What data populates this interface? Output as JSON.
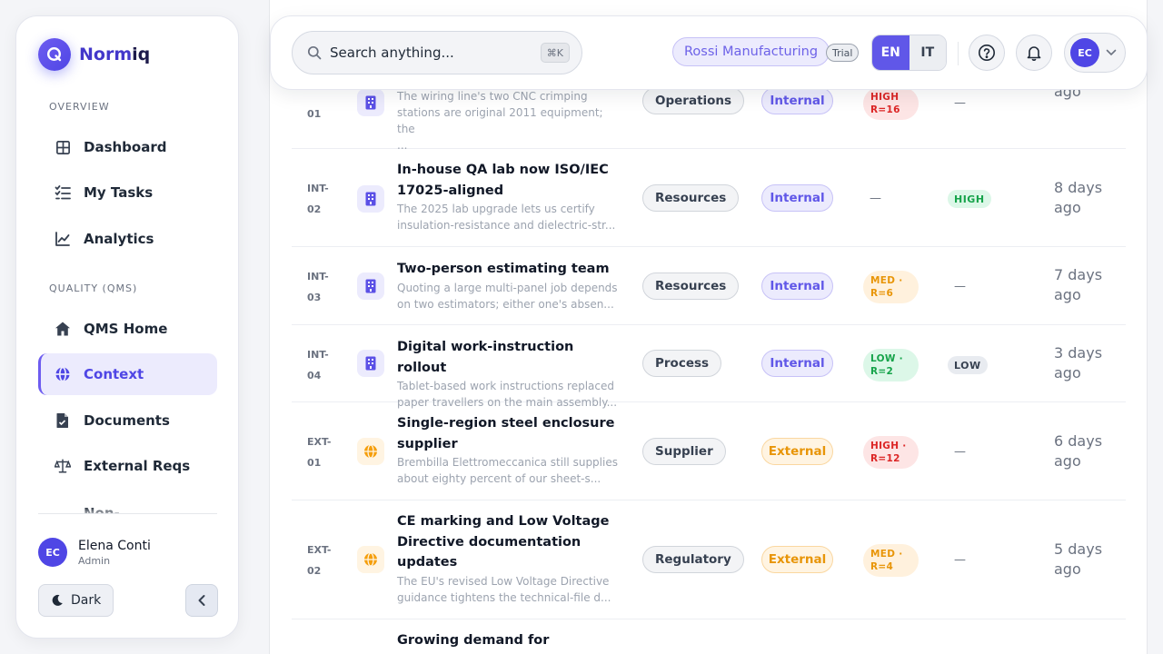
{
  "brand": {
    "name_a": "Norm",
    "name_b": "iq"
  },
  "sidebar": {
    "sections": [
      "OVERVIEW",
      "QUALITY (QMS)"
    ],
    "items": [
      {
        "label": "Dashboard",
        "icon": "grid-icon"
      },
      {
        "label": "My Tasks",
        "icon": "task-list-icon"
      },
      {
        "label": "Analytics",
        "icon": "line-chart-icon"
      },
      {
        "label": "QMS Home",
        "icon": "home-icon"
      },
      {
        "label": "Context",
        "icon": "globe-icon",
        "active": true
      },
      {
        "label": "Documents",
        "icon": "document-icon"
      },
      {
        "label": "External Reqs",
        "icon": "scale-icon"
      },
      {
        "label": "Non-",
        "icon": ""
      }
    ],
    "user": {
      "initials": "EC",
      "name": "Elena Conti",
      "role": "Admin"
    },
    "dark_label": "Dark"
  },
  "topbar": {
    "search_placeholder": "Search anything...",
    "shortcut": "⌘K",
    "org": "Rossi Manufacturing",
    "plan": "Trial",
    "lang": {
      "en": "EN",
      "it": "IT"
    },
    "avatar": "EC"
  },
  "rows": [
    {
      "id_bottom": "01",
      "type": "internal",
      "desc": [
        "The wiring line's two CNC crimping",
        "stations are original 2011 equipment; the",
        "..."
      ],
      "category": "Operations",
      "scope": "Internal",
      "risk": {
        "level": "high",
        "label": "HIGH",
        "score": "R=16"
      },
      "priority": null,
      "priority_dash": "—",
      "updated": [
        "",
        "ago"
      ]
    },
    {
      "id": [
        "INT-",
        "02"
      ],
      "type": "internal",
      "title": [
        "In-house QA lab now ISO/IEC",
        "17025-aligned"
      ],
      "desc": [
        "The 2025 lab upgrade lets us certify",
        "insulation-resistance and dielectric-str..."
      ],
      "category": "Resources",
      "scope": "Internal",
      "risk_dash": "—",
      "priority": {
        "level": "high",
        "label": "HIGH"
      },
      "updated": [
        "8 days",
        "ago"
      ]
    },
    {
      "id": [
        "INT-",
        "03"
      ],
      "type": "internal",
      "title": [
        "Two-person estimating team"
      ],
      "desc": [
        "Quoting a large multi-panel job depends",
        "on two estimators; either one's absen..."
      ],
      "category": "Resources",
      "scope": "Internal",
      "risk": {
        "level": "med",
        "label": "MED ·",
        "score": "R=6"
      },
      "priority_dash": "—",
      "updated": [
        "7 days",
        "ago"
      ]
    },
    {
      "id": [
        "INT-",
        "04"
      ],
      "type": "internal",
      "title": [
        "Digital work-instruction rollout"
      ],
      "desc": [
        "Tablet-based work instructions replaced",
        "paper travellers on the main assembly..."
      ],
      "category": "Process",
      "scope": "Internal",
      "risk": {
        "level": "low",
        "label": "LOW ·",
        "score": "R=2"
      },
      "priority": {
        "level": "low",
        "label": "LOW"
      },
      "updated": [
        "3 days",
        "ago"
      ]
    },
    {
      "id": [
        "EXT-",
        "01"
      ],
      "type": "external",
      "title": [
        "Single-region steel enclosure",
        "supplier"
      ],
      "desc": [
        "Brembilla Elettromeccanica still supplies",
        "about eighty percent of our sheet-s..."
      ],
      "category": "Supplier",
      "scope": "External",
      "risk": {
        "level": "high",
        "label": "HIGH ·",
        "score": "R=12"
      },
      "priority_dash": "—",
      "updated": [
        "6 days",
        "ago"
      ]
    },
    {
      "id": [
        "EXT-",
        "02"
      ],
      "type": "external",
      "title": [
        "CE marking and Low Voltage",
        "Directive documentation",
        "updates"
      ],
      "desc": [
        "The EU's revised Low Voltage Directive",
        "guidance tightens the technical-file d..."
      ],
      "category": "Regulatory",
      "scope": "External",
      "risk": {
        "level": "med",
        "label": "MED ·",
        "score": "R=4"
      },
      "priority_dash": "—",
      "updated": [
        "5 days",
        "ago"
      ]
    },
    {
      "title": [
        "Growing demand for"
      ]
    }
  ],
  "colors": {
    "accent": "#6057e8",
    "internal": "#6057e8",
    "external": "#e89508",
    "high": "#dc2626",
    "low": "#16a34a"
  }
}
